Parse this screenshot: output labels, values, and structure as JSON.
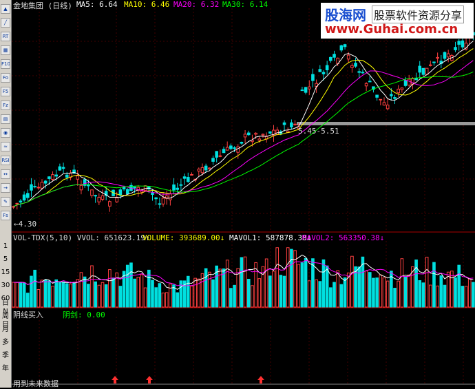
{
  "toolbar": {
    "buttons": [
      "▲",
      "╱",
      "RT",
      "▦",
      "F10",
      "Fo",
      "F5",
      "Fz",
      "▤",
      "◉",
      "≈",
      "RSI",
      "↔",
      "→",
      "✎",
      "Fs"
    ],
    "periods": [
      "日",
      "周",
      "月",
      "多",
      "季",
      "年"
    ]
  },
  "header": {
    "stock": "金地集团 (日线)",
    "ma5": "MA5: 6.64",
    "ma10": "MA10: 6.46",
    "ma20": "MA20: 6.32",
    "ma30": "MA30: 6.14",
    "colors": {
      "ma5": "#ffffff",
      "ma10": "#ffff00",
      "ma20": "#ff00ff",
      "ma30": "#00ff00"
    }
  },
  "logo": {
    "cn": "股海网",
    "slogan": "股票软件资源分享",
    "url": "www.Guhai.com.cn"
  },
  "price_panel": {
    "low_marker": "←4.30",
    "range_label": "5.45-5.51",
    "axis_labels": []
  },
  "volume_panel": {
    "header_prefix": "VOL-TDX(5,10) VVOL: 651623.19↑",
    "volume": "VOLUME: 393689.00↓",
    "mavol1": "MAVOL1: 587878.38↓",
    "mavol2": "MAVOL2: 563350.38↓",
    "axis_labels": [
      "1",
      "5",
      "15",
      "30",
      "60",
      "N",
      "日"
    ]
  },
  "indicator_panel": {
    "title": "阴线买入",
    "value": "阴剑: 0.00",
    "footer": "用到未来数据"
  },
  "chart_data": {
    "type": "line",
    "title": "金地集团 (日线)",
    "series": [
      {
        "name": "MA5",
        "values": [
          6.64
        ]
      },
      {
        "name": "MA10",
        "values": [
          6.46
        ]
      },
      {
        "name": "MA20",
        "values": [
          6.32
        ]
      },
      {
        "name": "MA30",
        "values": [
          6.14
        ]
      }
    ],
    "annotations": [
      "←4.30",
      "5.45-5.51"
    ]
  }
}
